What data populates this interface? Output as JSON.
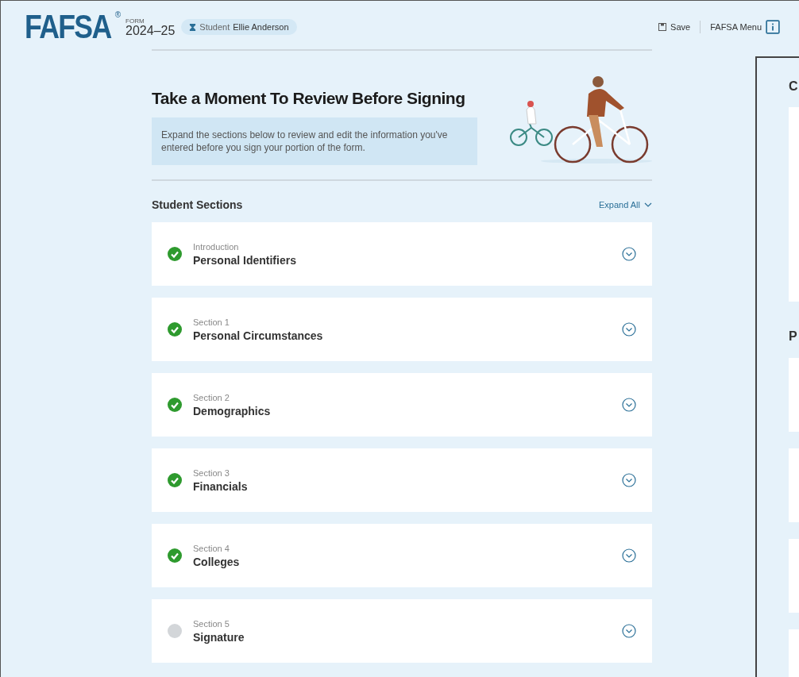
{
  "header": {
    "logo": "FAFSA",
    "logo_mark": "®",
    "form_label": "FORM",
    "form_year": "2024–25",
    "user_role": "Student",
    "user_name": "Ellie Anderson",
    "save": "Save",
    "menu": "FAFSA Menu"
  },
  "intro": {
    "title": "Take a Moment To Review Before Signing",
    "note": "Expand the sections below to review and edit the information you've entered before you sign your portion of the form."
  },
  "sections_header": {
    "title": "Student Sections",
    "expand_all": "Expand All"
  },
  "sections": [
    {
      "label": "Introduction",
      "title": "Personal Identifiers",
      "completed": true
    },
    {
      "label": "Section 1",
      "title": "Personal Circumstances",
      "completed": true
    },
    {
      "label": "Section 2",
      "title": "Demographics",
      "completed": true
    },
    {
      "label": "Section 3",
      "title": "Financials",
      "completed": true
    },
    {
      "label": "Section 4",
      "title": "Colleges",
      "completed": true
    },
    {
      "label": "Section 5",
      "title": "Signature",
      "completed": false
    }
  ],
  "side_panel": {
    "heading_1": "C",
    "heading_2": "P"
  }
}
